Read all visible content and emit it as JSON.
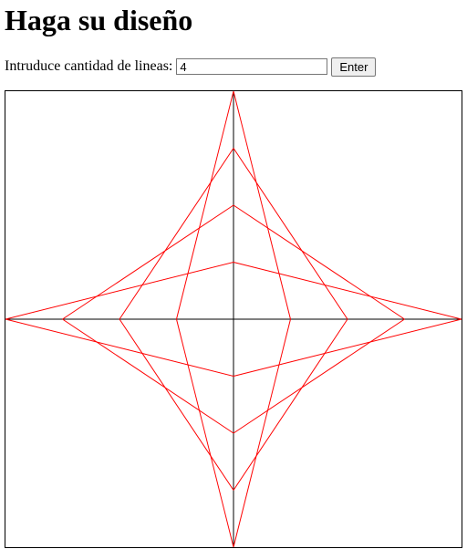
{
  "page": {
    "title": "Haga su diseño"
  },
  "form": {
    "label": "Intruduce cantidad de lineas:",
    "input_value": "4",
    "button_label": "Enter"
  },
  "design": {
    "line_count": 4,
    "axis_color": "#000000",
    "line_color": "#ff0000"
  }
}
